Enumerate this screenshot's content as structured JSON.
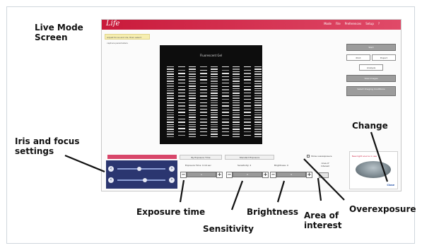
{
  "callouts": {
    "live_mode_screen": [
      "Live Mode",
      "Screen"
    ],
    "iris_focus": [
      "Iris and focus",
      "settings"
    ],
    "exposure_time": "Exposure time",
    "sensitivity": "Sensitivity",
    "brightness": "Brightness",
    "area_of_interest": [
      "Area of",
      "interest"
    ],
    "overexposure": "Overexposure",
    "change": "Change"
  },
  "app": {
    "logo": "Life",
    "menu": [
      "Mode",
      "File",
      "Preferences",
      "Setup",
      "?"
    ],
    "hint_text": "Adjust focus and iris, then select capture parameters",
    "gel_title": "Fluorescent Gel",
    "right_buttons": {
      "top": "Start",
      "print": "Print",
      "export": "Export",
      "analysis": "Analysis",
      "view_images": "View Images",
      "third": "Select Imaging Conditions"
    },
    "tabs": {
      "iris_tab": "Iris and focus",
      "exposure_tab": "By Exposure Time",
      "standard_tab": "Standard Exposure"
    },
    "show_overexposure": "Show overexposure",
    "controls": {
      "exposure_label": "Exposure Time: 0.10 sec",
      "sensitivity_label": "Sensitivity: 2",
      "brightness_label": "Brightness: 0",
      "exposure_value": "1",
      "sensitivity_value": "2",
      "brightness_value": "3"
    },
    "area_of_interest_label": [
      "Area of",
      "Interest"
    ],
    "change_panel_title": "New light source in use",
    "change_close": "Close"
  },
  "colors": {
    "brand_red": "#c91a3b",
    "iris_panel": "#2b3670",
    "gel_background": "#0d0d0d"
  }
}
